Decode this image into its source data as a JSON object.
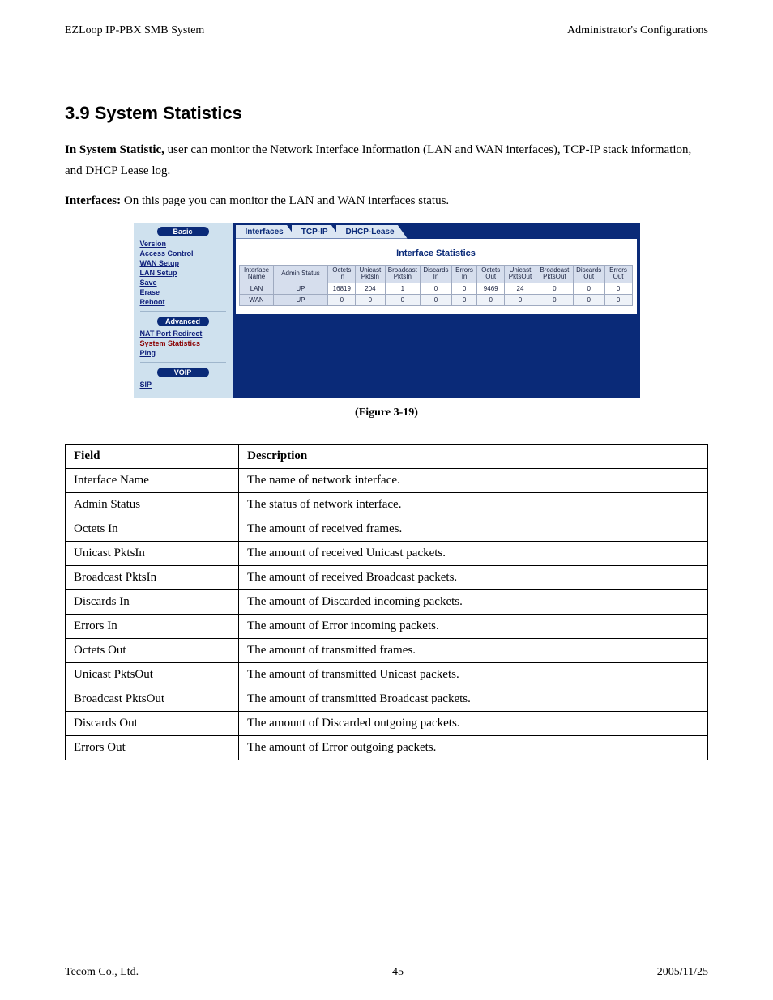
{
  "header": {
    "doc_title": "EZLoop IP-PBX SMB System",
    "chapter": "Administrator's Configurations"
  },
  "section_title": "3.9 System Statistics",
  "body": {
    "intro_bold": "In System Statistic,",
    "intro_rest": " user can monitor the Network Interface Information (LAN and WAN interfaces), TCP-IP stack information, and DHCP Lease log.",
    "interfaces_title": "Interfaces:",
    "interfaces_desc": " On this page you can monitor the LAN and WAN interfaces status.",
    "figure_caption": "(Figure 3-19)"
  },
  "sidebar": {
    "basic": {
      "header": "Basic",
      "items": [
        "Version",
        "Access Control",
        "WAN Setup",
        "LAN Setup",
        "Save",
        "Erase",
        "Reboot"
      ]
    },
    "advanced": {
      "header": "Advanced",
      "items": [
        "NAT Port Redirect",
        "System Statistics",
        "Ping"
      ],
      "active_index": 1
    },
    "voip": {
      "header": "VOIP",
      "items": [
        "SIP"
      ]
    }
  },
  "tabs": [
    "Interfaces",
    "TCP-IP",
    "DHCP-Lease"
  ],
  "stats": {
    "title": "Interface Statistics",
    "headers": [
      "Interface Name",
      "Admin Status",
      "Octets In",
      "Unicast PktsIn",
      "Broadcast PktsIn",
      "Discards In",
      "Errors In",
      "Octets Out",
      "Unicast PktsOut",
      "Broadcast PktsOut",
      "Discards Out",
      "Errors Out"
    ],
    "rows": [
      [
        "LAN",
        "UP",
        "16819",
        "204",
        "1",
        "0",
        "0",
        "9469",
        "24",
        "0",
        "0",
        "0"
      ],
      [
        "WAN",
        "UP",
        "0",
        "0",
        "0",
        "0",
        "0",
        "0",
        "0",
        "0",
        "0",
        "0"
      ]
    ]
  },
  "fields_table": {
    "headers": [
      "Field",
      "Description"
    ],
    "rows": [
      [
        "Interface Name",
        "The name of network interface."
      ],
      [
        "Admin Status",
        "The status of network interface."
      ],
      [
        "Octets In",
        "The amount of received frames."
      ],
      [
        "Unicast PktsIn",
        "The amount of received Unicast packets."
      ],
      [
        "Broadcast PktsIn",
        "The amount of received Broadcast packets."
      ],
      [
        "Discards In",
        "The amount of Discarded incoming packets."
      ],
      [
        "Errors In",
        "The amount of Error incoming packets."
      ],
      [
        "Octets Out",
        "The amount of transmitted frames."
      ],
      [
        "Unicast PktsOut",
        "The amount of transmitted Unicast packets."
      ],
      [
        "Broadcast PktsOut",
        "The amount of transmitted Broadcast packets."
      ],
      [
        "Discards Out",
        "The amount of Discarded outgoing packets."
      ],
      [
        "Errors Out",
        "The amount of Error outgoing packets."
      ]
    ]
  },
  "footer": {
    "left": "Tecom Co., Ltd.",
    "center": "45",
    "right": "2005/11/25"
  }
}
